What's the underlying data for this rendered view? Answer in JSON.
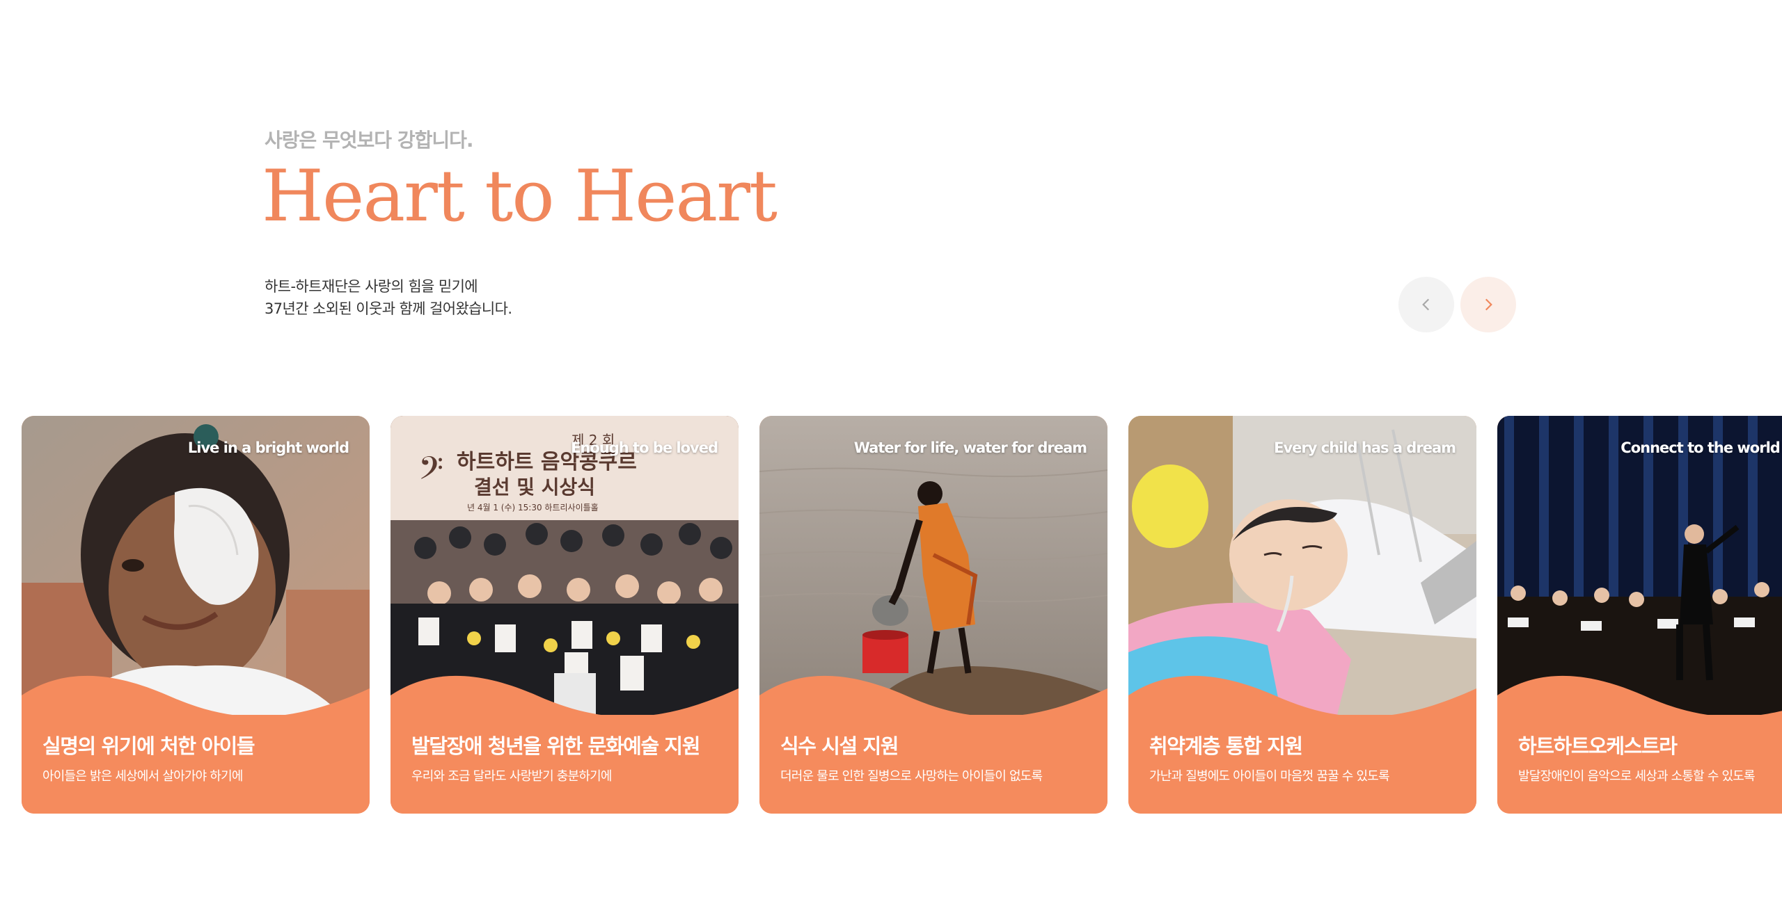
{
  "intro": {
    "kicker": "사랑은 무엇보다 강합니다.",
    "headline": "Heart to Heart",
    "desc_line1": "하트-하트재단은 사랑의 힘을 믿기에",
    "desc_line2": "37년간 소외된 이웃과 함께 걸어왔습니다."
  },
  "nav": {
    "prev_icon": "chevron-left-icon",
    "next_icon": "chevron-right-icon"
  },
  "colors": {
    "accent": "#f0875c",
    "card_bg": "#f58b5d",
    "kicker": "#b3b3b3"
  },
  "cards": [
    {
      "tag": "Live in a bright world",
      "title": "실명의 위기에 처한 아이들",
      "subtitle": "아이들은 밝은 세상에서 살아가야 하기에",
      "photo": "child-with-eye-patch-photo"
    },
    {
      "tag": "Enough to be loved",
      "title": "발달장애 청년을 위한 문화예술 지원",
      "subtitle": "우리와 조금 달라도 사랑받기 충분하기에",
      "photo": "music-contest-ceremony-photo",
      "banner_line1": "제 2 회",
      "banner_line2": "하트하트 음악콩쿠르",
      "banner_line3": "결선 및 시상식",
      "banner_line4": "년 4월 1 (수) 15:30  하트리사이틀홀"
    },
    {
      "tag": "Water for life, water for dream",
      "title": "식수 시설 지원",
      "subtitle": "더러운 물로 인한 질병으로 사망하는 아이들이 없도록",
      "photo": "child-fetching-water-photo"
    },
    {
      "tag": "Every child has a dream",
      "title": "취약계층 통합 지원",
      "subtitle": "가난과 질병에도 아이들이 마음껏 꿈꿀 수 있도록",
      "photo": "child-in-hospital-bed-photo"
    },
    {
      "tag": "Connect to the world with music",
      "title": "하트하트오케스트라",
      "subtitle": "발달장애인이 음악으로 세상과 소통할 수 있도록",
      "photo": "orchestra-concert-photo"
    }
  ]
}
